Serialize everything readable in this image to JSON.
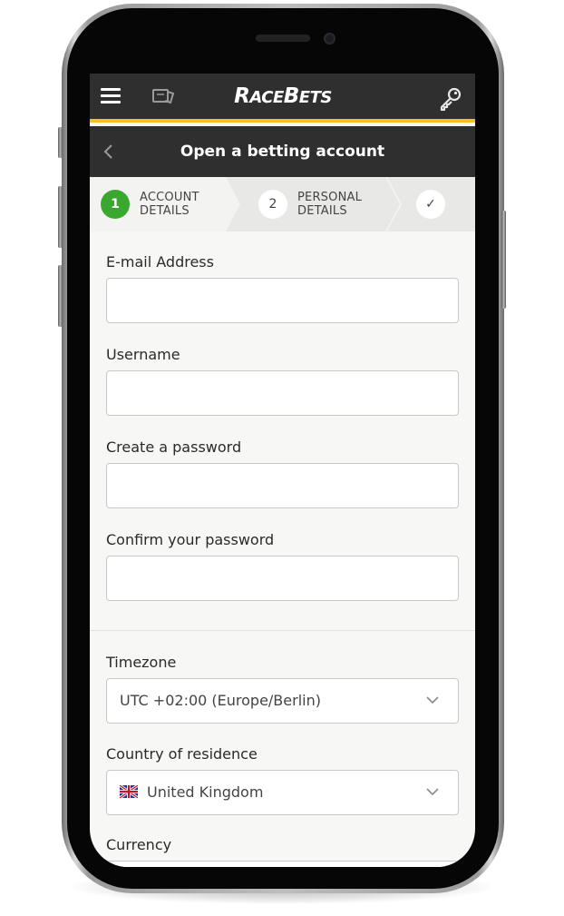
{
  "header": {
    "logo_text_caps": "R",
    "logo_text": "ACE",
    "logo_text_caps2": "B",
    "logo_text2": "ETS",
    "icons": {
      "menu": "hamburger-icon",
      "betslip": "ticket-icon",
      "login": "key-icon"
    }
  },
  "subheader": {
    "title": "Open a betting account",
    "back_icon": "chevron-left-icon"
  },
  "steps": [
    {
      "number": "1",
      "line1": "ACCOUNT",
      "line2": "DETAILS",
      "active": true
    },
    {
      "number": "2",
      "line1": "PERSONAL",
      "line2": "DETAILS",
      "active": false
    },
    {
      "number": "✓",
      "active": false
    }
  ],
  "form": {
    "email_label": "E-mail Address",
    "email_value": "",
    "username_label": "Username",
    "username_value": "",
    "password_label": "Create a password",
    "password_value": "",
    "confirm_label": "Confirm your password",
    "confirm_value": "",
    "timezone_label": "Timezone",
    "timezone_value": "UTC +02:00 (Europe/Berlin)",
    "country_label": "Country of residence",
    "country_value": "United Kingdom",
    "country_flag": "uk-flag-icon",
    "currency_label": "Currency"
  },
  "colors": {
    "header_bg": "#2f2f2f",
    "accent_yellow": "#f4c21b",
    "step_active_green": "#3aa82e"
  }
}
